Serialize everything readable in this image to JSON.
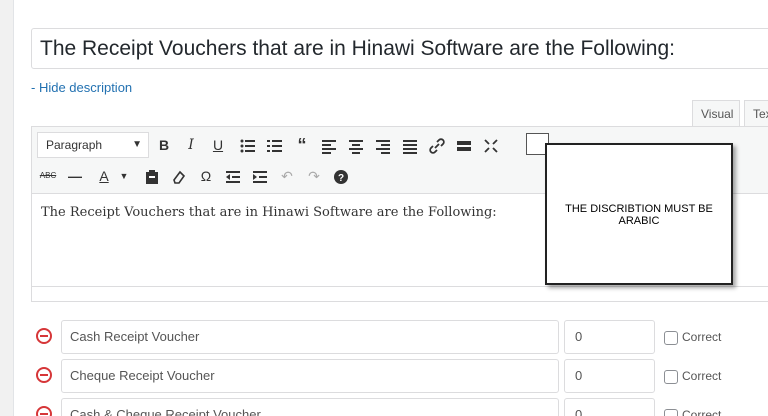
{
  "question": {
    "title": "The Receipt Vouchers that are in Hinawi Software are the Following:",
    "hide_description": "- Hide description"
  },
  "editor": {
    "tabs": [
      {
        "label": "Visual"
      },
      {
        "label": "Text"
      }
    ],
    "format_select": "Paragraph",
    "content": "The Receipt Vouchers that are in Hinawi Software are the Following:"
  },
  "note": {
    "text": "THE DISCRIBTION MUST BE ARABIC"
  },
  "answers": [
    {
      "text": "Cash Receipt Voucher",
      "points": "0",
      "correct_label": "Correct"
    },
    {
      "text": "Cheque Receipt Voucher",
      "points": "0",
      "correct_label": "Correct"
    },
    {
      "text": "Cash & Cheque Receipt Voucher",
      "points": "0",
      "correct_label": "Correct"
    }
  ],
  "colors": {
    "link": "#2271b1",
    "remove": "#d63638"
  }
}
